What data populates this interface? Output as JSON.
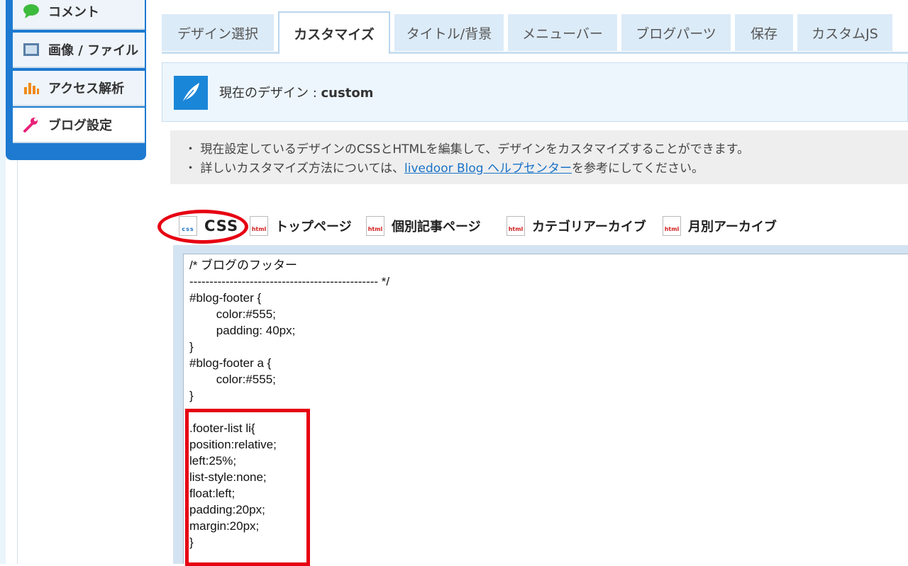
{
  "sidebar": {
    "items": [
      {
        "label": "コメント",
        "icon": "comment-icon"
      },
      {
        "label": "画像 / ファイル",
        "icon": "image-icon"
      },
      {
        "label": "アクセス解析",
        "icon": "bar-chart-icon"
      },
      {
        "label": "ブログ設定",
        "icon": "wrench-icon"
      }
    ]
  },
  "tabs": [
    "デザイン選択",
    "カスタマイズ",
    "タイトル/背景",
    "メニューバー",
    "ブログパーツ",
    "保存",
    "カスタムJS"
  ],
  "design": {
    "label": "現在のデザイン : ",
    "name": "custom"
  },
  "info": {
    "line1": "現在設定しているデザインのCSSとHTMLを編集して、デザインをカスタマイズすることができます。",
    "line2_prefix": "詳しいカスタマイズ方法については、",
    "line2_link": "livedoor Blog ヘルプセンター",
    "line2_suffix": "を参考にしてください。"
  },
  "file_tabs": [
    {
      "label": "CSS",
      "icon_text": "css"
    },
    {
      "label": "トップページ",
      "icon_text": "html"
    },
    {
      "label": "個別記事ページ",
      "icon_text": "html"
    },
    {
      "label": "カテゴリアーカイブ",
      "icon_text": "html"
    },
    {
      "label": "月別アーカイブ",
      "icon_text": "html"
    }
  ],
  "code": {
    "top": "/* ブログのフッター\n----------------------------------------------- */\n#blog-footer {\n        color:#555;\n        padding: 40px;\n}\n#blog-footer a {\n        color:#555;\n}",
    "highlight": ".footer-list li{\nposition:relative;\nleft:25%;\nlist-style:none;\nfloat:left;\npadding:20px;\nmargin:20px;\n}"
  },
  "colors": {
    "accent": "#1d7ad0",
    "highlight": "#e60012"
  }
}
